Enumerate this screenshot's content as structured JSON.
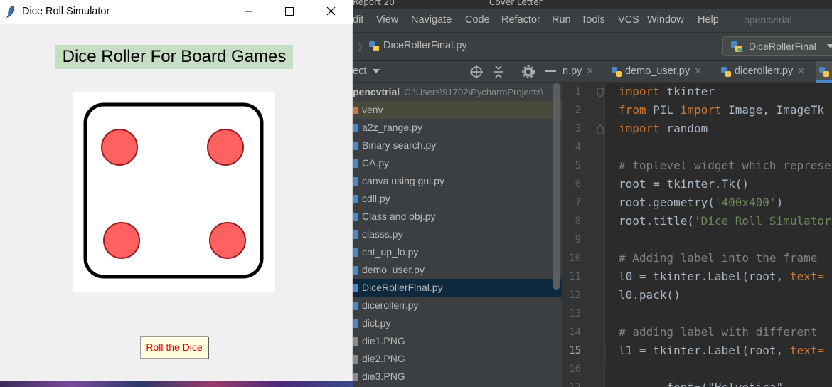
{
  "os_strip": {
    "left_text": "Report 20",
    "right_text": "Cover Letter"
  },
  "ide": {
    "menu": [
      "dit",
      "View",
      "Navigate",
      "Code",
      "Refactor",
      "Run",
      "Tools",
      "VCS",
      "Window",
      "Help"
    ],
    "project_name": "opencvtrial",
    "breadcrumb_file": "DiceRollerFinal.py",
    "run_config": "DiceRollerFinal",
    "project_panel_title": "ect",
    "tabs": [
      {
        "label": "n.py"
      },
      {
        "label": "demo_user.py"
      },
      {
        "label": "dicerollerr.py"
      }
    ],
    "tree": {
      "root_label": "pencvtrial",
      "root_path": "C:\\Users\\91702\\PycharmProjects\\",
      "items": [
        "venv",
        "a2z_range.py",
        "Binary search.py",
        "CA.py",
        "canva using gui.py",
        "cdll.py",
        "Class and obj.py",
        "classs.py",
        "cnt_up_lo.py",
        "demo_user.py",
        "DiceRollerFinal.py",
        "dicerollerr.py",
        "dict.py",
        "die1.PNG",
        "die2.PNG",
        "die3.PNG"
      ]
    },
    "line_numbers": [
      "1",
      "2",
      "3",
      "4",
      "5",
      "6",
      "7",
      "8",
      "9",
      "10",
      "11",
      "12",
      "13",
      "14",
      "15",
      "16",
      "17"
    ],
    "code": {
      "l1_kw": "import",
      "l1_rest": " tkinter",
      "l2_kw1": "from",
      "l2_mid": " PIL ",
      "l2_kw2": "import",
      "l2_rest": " Image, ImageTk",
      "l3_kw": "import",
      "l3_rest": " random",
      "l5_comment": "# toplevel widget which represents",
      "l6": "root = tkinter.Tk()",
      "l7_pre": "root.geometry(",
      "l7_str": "'400x400'",
      "l7_post": ")",
      "l8_pre": "root.title(",
      "l8_str": "'Dice Roll Simulator'",
      "l10_comment": "# Adding label into the frame",
      "l11_pre": "l0 = tkinter.Label(root, ",
      "l11_kw": "text=",
      "l12": "l0.pack()",
      "l14_comment": "# adding label with different",
      "l15_pre": "l1 = tkinter.Label(root, ",
      "l15_kw": "text=",
      "l17": "      .font=(\"Helvetica\",  "
    }
  },
  "app": {
    "window_title": "Dice Roll Simulator",
    "heading": "Dice Roller For Board Games",
    "roll_button": "Roll the Dice",
    "die_face_value": 4,
    "colors": {
      "heading_bg": "#c6dfc4",
      "pip": "#ff6060",
      "button_bg": "#ffffe0",
      "button_text": "#e00000"
    }
  }
}
